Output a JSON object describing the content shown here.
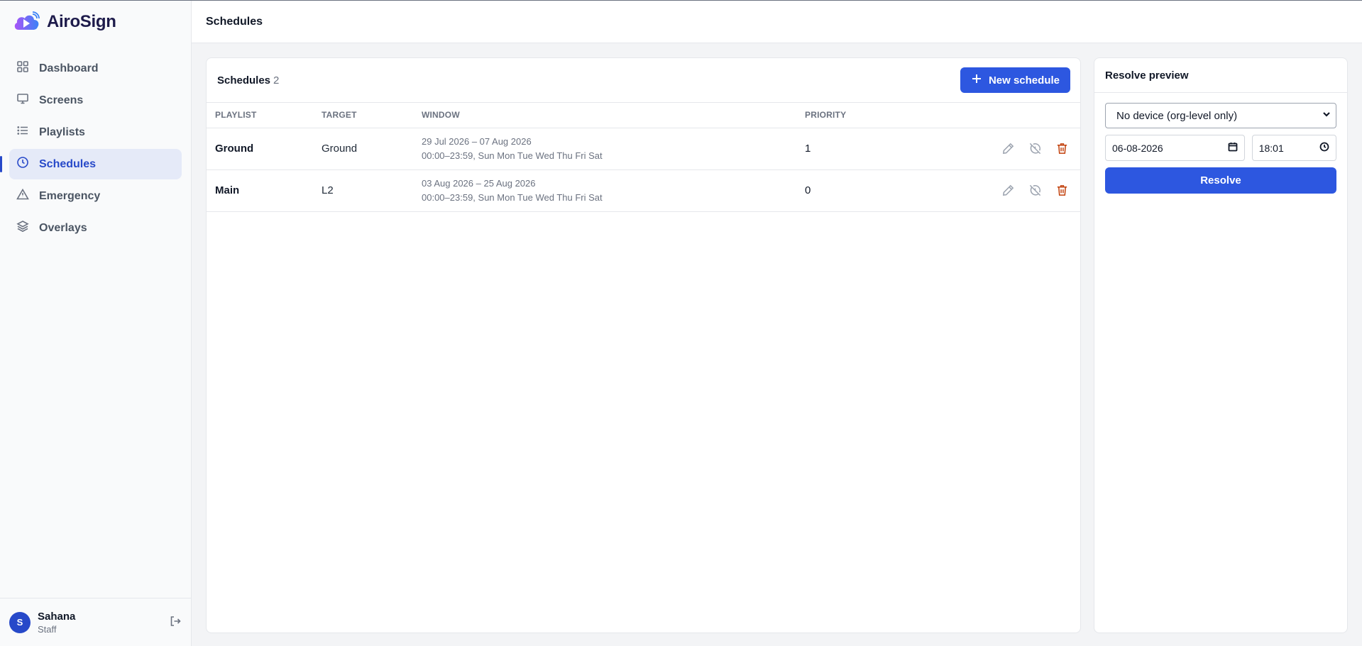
{
  "brand": {
    "name": "AiroSign",
    "logo_icon": "cloud-play-icon",
    "colors": {
      "primary": "#2d57e0",
      "logo_purple": "#8b5cf6",
      "logo_blue": "#3b82f6"
    }
  },
  "sidebar": {
    "items": [
      {
        "label": "Dashboard",
        "icon": "grid-icon",
        "active": false
      },
      {
        "label": "Screens",
        "icon": "monitor-icon",
        "active": false
      },
      {
        "label": "Playlists",
        "icon": "list-icon",
        "active": false
      },
      {
        "label": "Schedules",
        "icon": "clock-icon",
        "active": true
      },
      {
        "label": "Emergency",
        "icon": "alert-triangle-icon",
        "active": false
      },
      {
        "label": "Overlays",
        "icon": "layers-icon",
        "active": false
      }
    ],
    "user": {
      "initial": "S",
      "name": "Sahana",
      "role": "Staff",
      "logout_icon": "logout-icon"
    }
  },
  "topbar": {
    "title": "Schedules"
  },
  "schedules": {
    "title": "Schedules",
    "count": "2",
    "new_button": "New schedule",
    "columns": [
      "Playlist",
      "Target",
      "Window",
      "Priority"
    ],
    "rows": [
      {
        "playlist": "Ground",
        "target": "Ground",
        "window_dates": "29 Jul 2026 – 07 Aug 2026",
        "window_times": "00:00–23:59, Sun Mon Tue Wed Thu Fri Sat",
        "priority": "1"
      },
      {
        "playlist": "Main",
        "target": "L2",
        "window_dates": "03 Aug 2026 – 25 Aug 2026",
        "window_times": "00:00–23:59, Sun Mon Tue Wed Thu Fri Sat",
        "priority": "0"
      }
    ]
  },
  "preview": {
    "title": "Resolve preview",
    "device_select": "No device (org-level only)",
    "date_value": "06-08-2026",
    "time_value": "18:01",
    "resolve_button": "Resolve"
  }
}
